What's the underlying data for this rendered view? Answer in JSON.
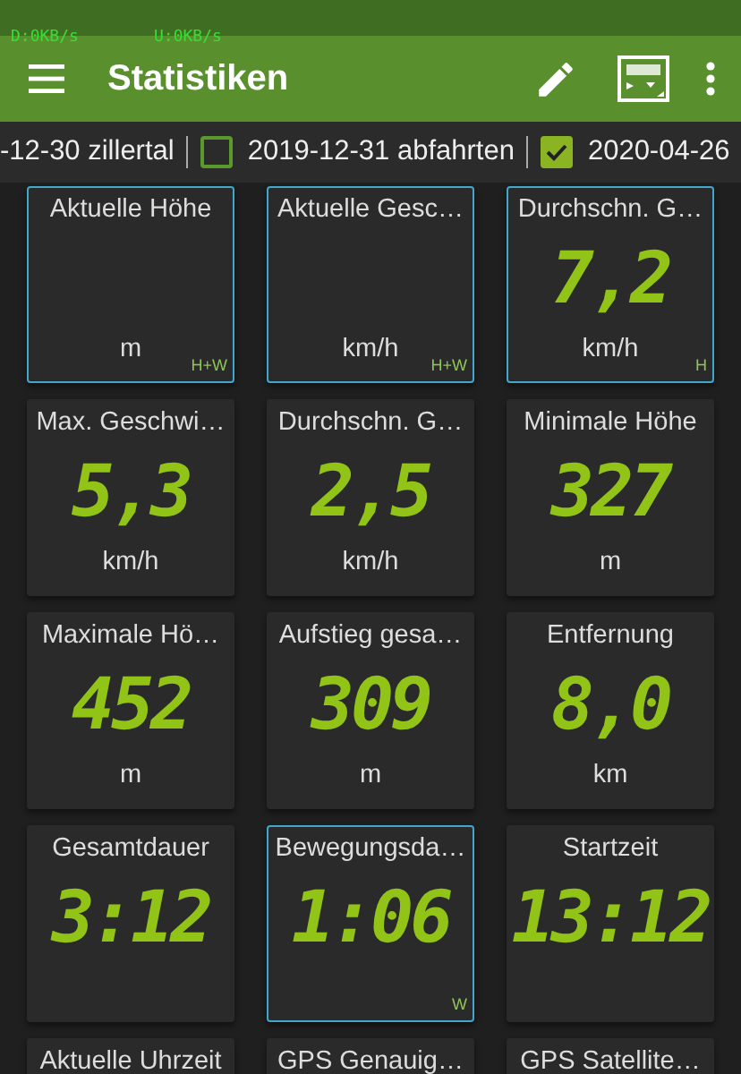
{
  "netspeed": {
    "download": "D:0KB/s",
    "upload": "U:0KB/s"
  },
  "toolbar": {
    "title": "Statistiken"
  },
  "tracks": [
    {
      "label": "-12-30 zillertal"
    },
    {
      "label": "2019-12-31 abfahrten",
      "checked": false
    },
    {
      "label": "2020-04-26",
      "checked": true
    }
  ],
  "tiles": [
    {
      "title": "Aktuelle Höhe",
      "unit": "m",
      "source": "H+W",
      "highlighted": true
    },
    {
      "title": "Aktuelle Gesc…",
      "unit": "km/h",
      "source": "H+W",
      "highlighted": true
    },
    {
      "title": "Durchschn. G…",
      "value": "7,2",
      "unit": "km/h",
      "source": "H",
      "highlighted": true
    },
    {
      "title": "Max. Geschwi…",
      "value": "5,3",
      "unit": "km/h",
      "highlighted": false
    },
    {
      "title": "Durchschn. G…",
      "value": "2,5",
      "unit": "km/h",
      "highlighted": false
    },
    {
      "title": "Minimale Höhe",
      "value": "327",
      "unit": "m",
      "highlighted": false
    },
    {
      "title": "Maximale Hö…",
      "value": "452",
      "unit": "m",
      "highlighted": false
    },
    {
      "title": "Aufstieg gesa…",
      "value": "309",
      "unit": "m",
      "highlighted": false
    },
    {
      "title": "Entfernung",
      "value": "8,0",
      "unit": "km",
      "highlighted": false
    },
    {
      "title": "Gesamtdauer",
      "value": "3:12",
      "highlighted": false
    },
    {
      "title": "Bewegungsda…",
      "value": "1:06",
      "source": "W",
      "highlighted": true
    },
    {
      "title": "Startzeit",
      "value": "13:12",
      "highlighted": false
    },
    {
      "title": "Aktuelle Uhrzeit",
      "highlighted": false
    },
    {
      "title": "GPS Genauig…",
      "highlighted": false
    },
    {
      "title": "GPS Satellite…",
      "highlighted": false
    }
  ]
}
